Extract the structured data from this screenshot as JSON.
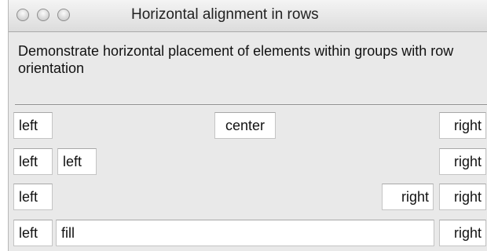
{
  "window": {
    "title": "Horizontal alignment in rows",
    "description": "Demonstrate horizontal placement of elements within groups with row orientation"
  },
  "rows": [
    {
      "items": [
        "left",
        "center",
        "right"
      ]
    },
    {
      "items": [
        "left",
        "left",
        "right"
      ]
    },
    {
      "items": [
        "left",
        "right",
        "right"
      ]
    },
    {
      "items": [
        "left",
        "fill",
        "right"
      ]
    }
  ]
}
